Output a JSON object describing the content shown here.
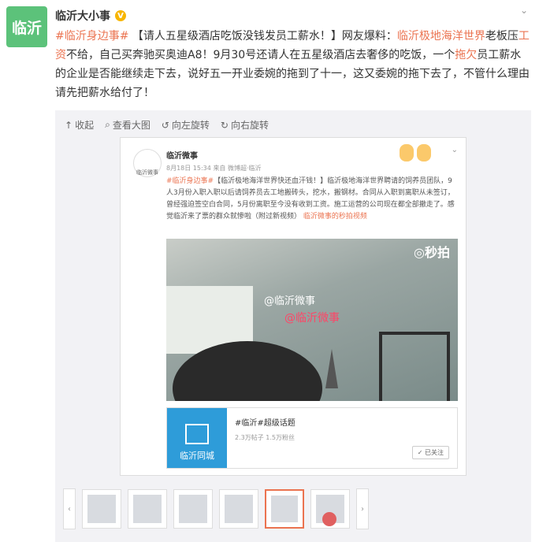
{
  "account": {
    "avatar_text": "临沂",
    "name": "临沂大小事",
    "verified_badge": "V"
  },
  "post": {
    "segments": [
      {
        "text": "#临沂身边事#",
        "style": "link"
      },
      {
        "text": " 【请人五星级酒店吃饭没钱发员工薪水！】网友爆料：",
        "style": "plain"
      },
      {
        "text": "临沂极地海洋世界",
        "style": "hl"
      },
      {
        "text": "老板压",
        "style": "plain"
      },
      {
        "text": "工资",
        "style": "hl"
      },
      {
        "text": "不给，自己买奔驰买奥迪A8！9月30号还请人在五星级酒店去奢侈的吃饭，一个",
        "style": "plain"
      },
      {
        "text": "拖欠",
        "style": "hl"
      },
      {
        "text": "员工薪水的企业是否能继续走下去，说好五一开业委婉的拖到了十一，这又委婉的拖下去了，不管什么理由请先把薪水给付了！",
        "style": "plain"
      }
    ]
  },
  "toolbar": {
    "collapse": "收起",
    "view_large": "查看大图",
    "rotate_left": "向左旋转",
    "rotate_right": "向右旋转"
  },
  "screenshot": {
    "name": "临沂微事",
    "meta": "8月18日 15:34 来自 微博超·临沂",
    "avatar_caption": "临沂微事",
    "text_segments": [
      {
        "text": "#临沂身边事#",
        "style": "link"
      },
      {
        "text": "【临沂极地海洋世界快还血汗钱！】临沂极地海洋世界聘请的饲养员团队，9人3月份入职入职以后请饲养员去工地搬砖头，挖水，搬钢材。合同从入职到离职从未签订，曾经强迫签空白合同，5月份离职至今没有收到工资。施工运营的公司现在都全部撤走了。感觉临沂来了票的群众就惨啦（附过新视频）",
        "style": "plain"
      },
      {
        "text": " 临沂微事的秒拍视频",
        "style": "link"
      }
    ],
    "video_watermark": "◎秒拍",
    "video_overlay_1": "@临沂微事",
    "video_overlay_2": "@临沂微事",
    "card": {
      "image_label": "临沂同城",
      "title": "#临沂#超级话题",
      "subtitle": "2.3万帖子  1.5万粉丝",
      "follow_label": "✓ 已关注"
    }
  },
  "thumbnail_strip": {
    "prev": "‹",
    "next": "›",
    "count": 6,
    "active_index": 4
  }
}
